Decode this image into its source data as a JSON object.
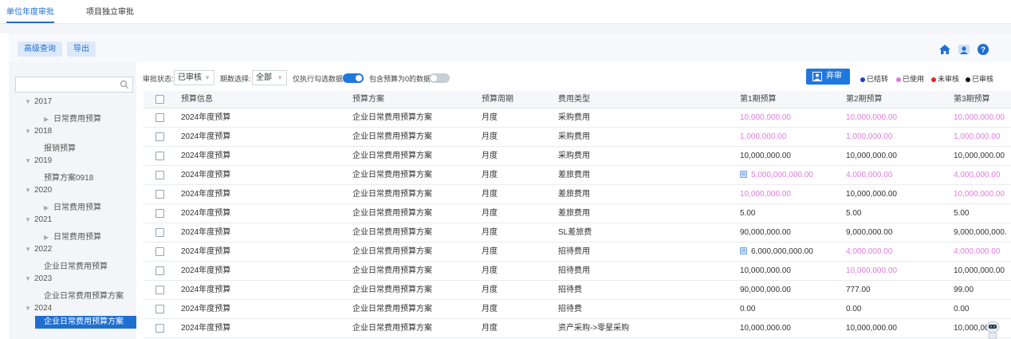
{
  "tabs": [
    {
      "label": "单位年度审批",
      "active": true
    },
    {
      "label": "项目独立审批",
      "active": false
    }
  ],
  "toolbar": {
    "advanced_search_label": "高级查询",
    "export_label": "导出",
    "icons": [
      "home-icon",
      "user-icon",
      "help-icon"
    ]
  },
  "sidebar": {
    "search_placeholder": "",
    "tree": [
      {
        "year": "2017",
        "children": [
          {
            "label": "日常费用预算",
            "has_children": true
          }
        ]
      },
      {
        "year": "2018",
        "children": [
          {
            "label": "报销预算",
            "has_children": false
          }
        ]
      },
      {
        "year": "2019",
        "children": [
          {
            "label": "预算方案0918",
            "has_children": false
          }
        ]
      },
      {
        "year": "2020",
        "children": [
          {
            "label": "日常费用预算",
            "has_children": true
          }
        ]
      },
      {
        "year": "2021",
        "children": [
          {
            "label": "日常费用预算",
            "has_children": true
          }
        ]
      },
      {
        "year": "2022",
        "children": [
          {
            "label": "企业日常费用预算",
            "has_children": false
          }
        ]
      },
      {
        "year": "2023",
        "children": [
          {
            "label": "企业日常费用预算方案",
            "has_children": false
          }
        ]
      },
      {
        "year": "2024",
        "children": [
          {
            "label": "企业日常费用预算方案",
            "has_children": false,
            "selected": true
          }
        ]
      }
    ]
  },
  "filters": {
    "status_label": "审批状态:",
    "status_value": "已审核",
    "period_label": "期数选择:",
    "period_value": "全部",
    "only_checked_label": "仅执行勾选数据:",
    "only_checked_on": true,
    "include_zero_label": "包含预算为0的数据:",
    "include_zero_on": false
  },
  "approve_button_label": "弃审",
  "legend": [
    {
      "label": "已结转",
      "color": "#1a3fd6"
    },
    {
      "label": "已使用",
      "color": "#e07ad8"
    },
    {
      "label": "未审核",
      "color": "#e02424"
    },
    {
      "label": "已审核",
      "color": "#111111"
    }
  ],
  "colors": {
    "pink": "#e27be0",
    "black": "#333333",
    "accent": "#1f6fd1"
  },
  "table": {
    "columns": [
      "预算信息",
      "预算方案",
      "预算周期",
      "费用类型",
      "第1期预算",
      "第2期预算",
      "第3期预算"
    ],
    "rows": [
      {
        "info": "2024年度预算",
        "plan": "企业日常费用预算方案",
        "period": "月度",
        "type": "采购费用",
        "p1": "10,000,000.00",
        "p1_color": "pink",
        "p2": "10,000,000.00",
        "p2_color": "pink",
        "p3": "10,000,000.00",
        "p3_color": "pink"
      },
      {
        "info": "2024年度预算",
        "plan": "企业日常费用预算方案",
        "period": "月度",
        "type": "采购费用",
        "p1": "1,000,000.00",
        "p1_color": "pink",
        "p2": "1,000,000.00",
        "p2_color": "pink",
        "p3": "1,000,000.00",
        "p3_color": "pink"
      },
      {
        "info": "2024年度预算",
        "plan": "企业日常费用预算方案",
        "period": "月度",
        "type": "采购费用",
        "p1": "10,000,000.00",
        "p1_color": "black",
        "p2": "10,000,000.00",
        "p2_color": "black",
        "p3": "10,000,000.00",
        "p3_color": "black"
      },
      {
        "info": "2024年度预算",
        "plan": "企业日常费用预算方案",
        "period": "月度",
        "type": "差旅费用",
        "p1": "5,000,000,000.00",
        "p1_color": "pink",
        "p1_icon": true,
        "p2": "4,000,000.00",
        "p2_color": "pink",
        "p3": "4,000,000.00",
        "p3_color": "pink"
      },
      {
        "info": "2024年度预算",
        "plan": "企业日常费用预算方案",
        "period": "月度",
        "type": "差旅费用",
        "p1": "10,000,000.00",
        "p1_color": "pink",
        "p2": "10,000,000.00",
        "p2_color": "black",
        "p3": "10,000,000.00",
        "p3_color": "pink"
      },
      {
        "info": "2024年度预算",
        "plan": "企业日常费用预算方案",
        "period": "月度",
        "type": "差旅费用",
        "p1": "5.00",
        "p1_color": "black",
        "p2": "5.00",
        "p2_color": "black",
        "p3": "5.00",
        "p3_color": "black"
      },
      {
        "info": "2024年度预算",
        "plan": "企业日常费用预算方案",
        "period": "月度",
        "type": "SL差旅费",
        "p1": "90,000,000.00",
        "p1_color": "black",
        "p2": "9,000,000.00",
        "p2_color": "black",
        "p3": "9,000,000,000.",
        "p3_color": "black"
      },
      {
        "info": "2024年度预算",
        "plan": "企业日常费用预算方案",
        "period": "月度",
        "type": "招待费用",
        "p1": "6,000,000,000.00",
        "p1_color": "black",
        "p1_icon": true,
        "p2": "4,000,000.00",
        "p2_color": "pink",
        "p3": "4,000,000.00",
        "p3_color": "pink"
      },
      {
        "info": "2024年度预算",
        "plan": "企业日常费用预算方案",
        "period": "月度",
        "type": "招待费用",
        "p1": "10,000,000.00",
        "p1_color": "black",
        "p2": "10,000,000.00",
        "p2_color": "pink",
        "p3": "10,000,000.00",
        "p3_color": "black"
      },
      {
        "info": "2024年度预算",
        "plan": "企业日常费用预算方案",
        "period": "月度",
        "type": "招待费",
        "p1": "90,000,000.00",
        "p1_color": "black",
        "p2": "777.00",
        "p2_color": "black",
        "p3": "99.00",
        "p3_color": "black"
      },
      {
        "info": "2024年度预算",
        "plan": "企业日常费用预算方案",
        "period": "月度",
        "type": "招待费",
        "p1": "0.00",
        "p1_color": "black",
        "p2": "0.00",
        "p2_color": "black",
        "p3": "0.00",
        "p3_color": "black"
      },
      {
        "info": "2024年度预算",
        "plan": "企业日常费用预算方案",
        "period": "月度",
        "type": "资产采购->零星采购",
        "p1": "10,000,000.00",
        "p1_color": "black",
        "p2": "10,000,000.00",
        "p2_color": "black",
        "p3": "10,000,000",
        "p3_color": "black"
      }
    ]
  }
}
